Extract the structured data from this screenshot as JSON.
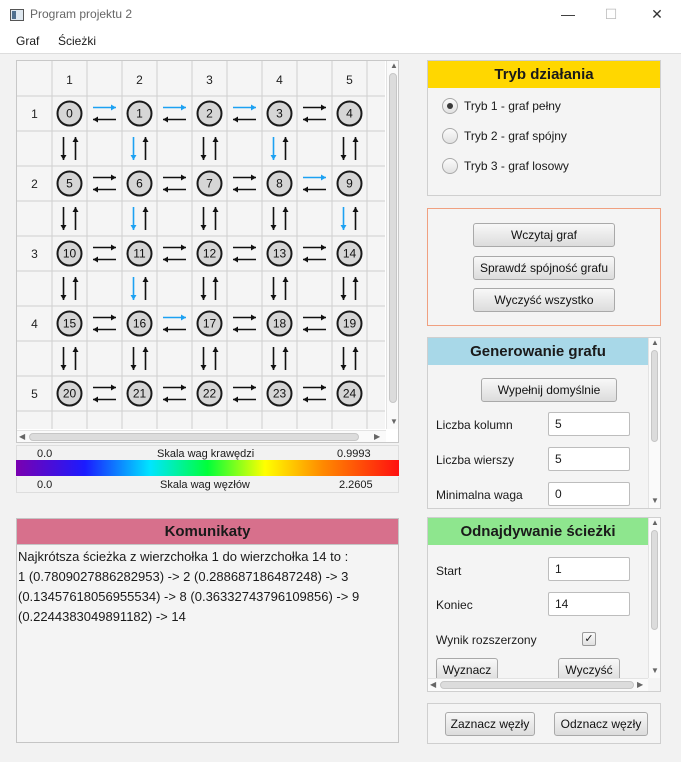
{
  "window": {
    "title": "Program projektu 2",
    "minimize": "—",
    "maximize": "☐",
    "close": "✕"
  },
  "menu": {
    "items": [
      "Graf",
      "Ścieżki"
    ]
  },
  "graph": {
    "column_headers": [
      "1",
      "2",
      "3",
      "4",
      "5"
    ],
    "row_headers": [
      "1",
      "2",
      "3",
      "4",
      "5"
    ],
    "nodes": [
      [
        0,
        1,
        2,
        3,
        4
      ],
      [
        5,
        6,
        7,
        8,
        9
      ],
      [
        10,
        11,
        12,
        13,
        14
      ],
      [
        15,
        16,
        17,
        18,
        19
      ],
      [
        20,
        21,
        22,
        23,
        24
      ]
    ],
    "highlighted_horizontal": [
      [
        0,
        0
      ],
      [
        0,
        1
      ],
      [
        0,
        2
      ],
      [
        1,
        3
      ],
      [
        3,
        1
      ]
    ],
    "highlighted_vertical": [
      [
        0,
        1
      ],
      [
        0,
        3
      ],
      [
        1,
        1
      ],
      [
        1,
        4
      ],
      [
        2,
        1
      ]
    ],
    "colors": {
      "normal_arrow": "#111111",
      "highlighted_arrow": "#1da1f2"
    }
  },
  "scales": {
    "edge": {
      "min": "0.0",
      "label": "Skala wag krawędzi",
      "max": "0.9993"
    },
    "node": {
      "min": "0.0",
      "label": "Skala wag węzłów",
      "max": "2.2605"
    }
  },
  "messages": {
    "title": "Komunikaty",
    "lines": [
      "Najkrótsza ścieżka z wierzchołka 1 do wierzchołka 14 to :",
      "1 (0.7809027886282953) -> 2 (0.288687186487248) -> 3",
      "(0.13457618056955534) -> 8 (0.36332743796109856) -> 9",
      "(0.2244383049891182) -> 14"
    ],
    "header_color": "#d7708c"
  },
  "mode": {
    "title": "Tryb działania",
    "header_color": "#ffd700",
    "options": [
      "Tryb 1 - graf pełny",
      "Tryb 2 - graf spójny",
      "Tryb 3 - graf losowy"
    ],
    "selected_index": 0
  },
  "actions": {
    "load": "Wczytaj graf",
    "check": "Sprawdź spójność grafu",
    "clear_all": "Wyczyść wszystko",
    "border_color": "#f0a080"
  },
  "generate": {
    "title": "Generowanie grafu",
    "header_color": "#a8d8e8",
    "fill_default": "Wypełnij domyślnie",
    "columns_label": "Liczba kolumn",
    "columns_value": "5",
    "rows_label": "Liczba wierszy",
    "rows_value": "5",
    "min_weight_label": "Minimalna waga",
    "min_weight_value": "0"
  },
  "path": {
    "title": "Odnajdywanie ścieżki",
    "header_color": "#8ee68e",
    "start_label": "Start",
    "start_value": "1",
    "end_label": "Koniec",
    "end_value": "14",
    "extended_label": "Wynik rozszerzony",
    "extended_checked": true,
    "find": "Wyznacz",
    "clear": "Wyczyść"
  },
  "bottom": {
    "mark": "Zaznacz węzły",
    "unmark": "Odznacz węzły"
  }
}
